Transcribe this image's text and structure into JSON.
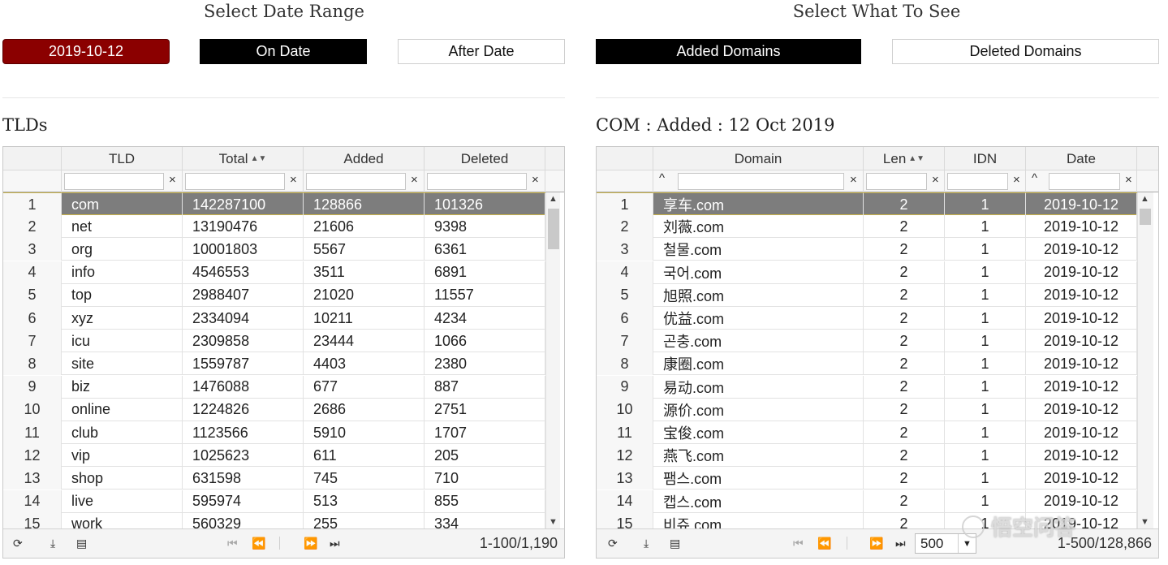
{
  "date_section": {
    "title": "Select Date Range",
    "date_value": "2019-10-12",
    "on_date_label": "On Date",
    "after_date_label": "After Date"
  },
  "view_section": {
    "title": "Select What To See",
    "added_label": "Added Domains",
    "deleted_label": "Deleted Domains"
  },
  "tlds": {
    "title": "TLDs",
    "columns": [
      "TLD",
      "Total",
      "Added",
      "Deleted"
    ],
    "rows": [
      {
        "n": "1",
        "tld": "com",
        "total": "142287100",
        "added": "128866",
        "deleted": "101326"
      },
      {
        "n": "2",
        "tld": "net",
        "total": "13190476",
        "added": "21606",
        "deleted": "9398"
      },
      {
        "n": "3",
        "tld": "org",
        "total": "10001803",
        "added": "5567",
        "deleted": "6361"
      },
      {
        "n": "4",
        "tld": "info",
        "total": "4546553",
        "added": "3511",
        "deleted": "6891"
      },
      {
        "n": "5",
        "tld": "top",
        "total": "2988407",
        "added": "21020",
        "deleted": "11557"
      },
      {
        "n": "6",
        "tld": "xyz",
        "total": "2334094",
        "added": "10211",
        "deleted": "4234"
      },
      {
        "n": "7",
        "tld": "icu",
        "total": "2309858",
        "added": "23444",
        "deleted": "1066"
      },
      {
        "n": "8",
        "tld": "site",
        "total": "1559787",
        "added": "4403",
        "deleted": "2380"
      },
      {
        "n": "9",
        "tld": "biz",
        "total": "1476088",
        "added": "677",
        "deleted": "887"
      },
      {
        "n": "10",
        "tld": "online",
        "total": "1224826",
        "added": "2686",
        "deleted": "2751"
      },
      {
        "n": "11",
        "tld": "club",
        "total": "1123566",
        "added": "5910",
        "deleted": "1707"
      },
      {
        "n": "12",
        "tld": "vip",
        "total": "1025623",
        "added": "611",
        "deleted": "205"
      },
      {
        "n": "13",
        "tld": "shop",
        "total": "631598",
        "added": "745",
        "deleted": "710"
      },
      {
        "n": "14",
        "tld": "live",
        "total": "595974",
        "added": "513",
        "deleted": "855"
      },
      {
        "n": "15",
        "tld": "work",
        "total": "560329",
        "added": "255",
        "deleted": "334"
      }
    ],
    "page_info": "1-100/1,190"
  },
  "domains": {
    "title": "COM : Added : 12 Oct 2019",
    "columns": [
      "Domain",
      "Len",
      "IDN",
      "Date"
    ],
    "rows": [
      {
        "n": "1",
        "domain": "享车.com",
        "len": "2",
        "idn": "1",
        "date": "2019-10-12"
      },
      {
        "n": "2",
        "domain": "刘薇.com",
        "len": "2",
        "idn": "1",
        "date": "2019-10-12"
      },
      {
        "n": "3",
        "domain": "철물.com",
        "len": "2",
        "idn": "1",
        "date": "2019-10-12"
      },
      {
        "n": "4",
        "domain": "국어.com",
        "len": "2",
        "idn": "1",
        "date": "2019-10-12"
      },
      {
        "n": "5",
        "domain": "旭照.com",
        "len": "2",
        "idn": "1",
        "date": "2019-10-12"
      },
      {
        "n": "6",
        "domain": "优益.com",
        "len": "2",
        "idn": "1",
        "date": "2019-10-12"
      },
      {
        "n": "7",
        "domain": "곤충.com",
        "len": "2",
        "idn": "1",
        "date": "2019-10-12"
      },
      {
        "n": "8",
        "domain": "康圈.com",
        "len": "2",
        "idn": "1",
        "date": "2019-10-12"
      },
      {
        "n": "9",
        "domain": "易动.com",
        "len": "2",
        "idn": "1",
        "date": "2019-10-12"
      },
      {
        "n": "10",
        "domain": "源价.com",
        "len": "2",
        "idn": "1",
        "date": "2019-10-12"
      },
      {
        "n": "11",
        "domain": "宝俊.com",
        "len": "2",
        "idn": "1",
        "date": "2019-10-12"
      },
      {
        "n": "12",
        "domain": "燕飞.com",
        "len": "2",
        "idn": "1",
        "date": "2019-10-12"
      },
      {
        "n": "13",
        "domain": "팸스.com",
        "len": "2",
        "idn": "1",
        "date": "2019-10-12"
      },
      {
        "n": "14",
        "domain": "캡스.com",
        "len": "2",
        "idn": "1",
        "date": "2019-10-12"
      },
      {
        "n": "15",
        "domain": "비쥬.com",
        "len": "2",
        "idn": "1",
        "date": "2019-10-12"
      }
    ],
    "page_size": "500",
    "page_info": "1-500/128,866"
  },
  "watermark": "悟空问答",
  "colors": {
    "date_button": "#8b0000",
    "active_button": "#000000",
    "selected_row": "#7d7d7d"
  },
  "icons": {
    "refresh": "refresh-icon",
    "download": "download-icon",
    "document": "document-icon",
    "first": "first-page-icon",
    "prev": "prev-page-icon",
    "next": "next-page-icon",
    "last": "last-page-icon"
  }
}
